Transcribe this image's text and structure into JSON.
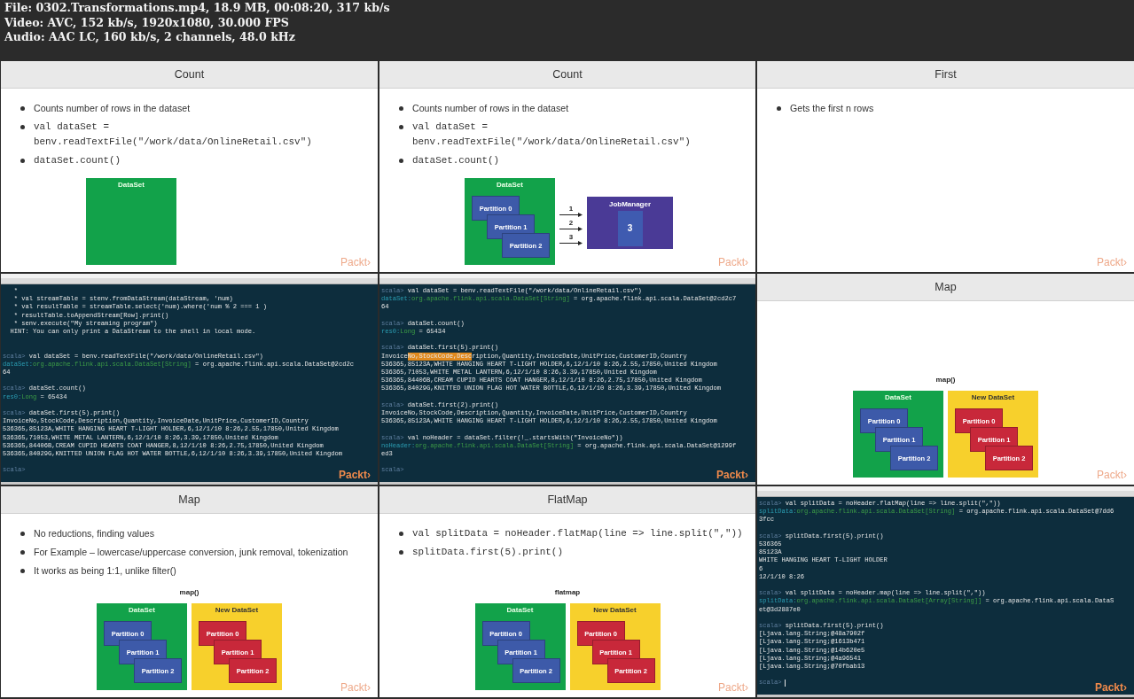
{
  "header": {
    "lines": [
      "File: 0302.Transformations.mp4, 18.9 MB, 00:08:20, 317 kb/s",
      "Video: AVC, 152 kb/s, 1920x1080, 30.000 FPS",
      "Audio: AAC LC, 160 kb/s, 2 channels, 48.0 kHz"
    ]
  },
  "cells": [
    {
      "kind": "slide",
      "title": "Count",
      "bullets": [
        {
          "kind": "text",
          "text": "Counts number of rows in the dataset"
        },
        {
          "kind": "code",
          "text": "val dataSet = benv.readTextFile(\"/work/data/OnlineRetail.csv\")"
        },
        {
          "kind": "code",
          "text": "dataSet.count()"
        }
      ],
      "diagram": {
        "kind": "dataset",
        "boxes": [
          {
            "kind": "source",
            "title": "DataSet"
          }
        ]
      },
      "logo": "Packt›"
    },
    {
      "kind": "slide",
      "title": "Count",
      "bullets": [
        {
          "kind": "text",
          "text": "Counts number of rows in the dataset"
        },
        {
          "kind": "code",
          "text": "val dataSet = benv.readTextFile(\"/work/data/OnlineRetail.csv\")"
        },
        {
          "kind": "code",
          "text": "dataSet.count()"
        }
      ],
      "diagram": {
        "kind": "jobmanager",
        "boxes": [
          {
            "kind": "source",
            "title": "DataSet",
            "partitions": [
              "Partition 0",
              "Partition 1",
              "Partition 2"
            ]
          }
        ],
        "arrows": [
          "1",
          "2",
          "3"
        ],
        "target": {
          "title": "JobManager",
          "value": "3"
        }
      },
      "logo": "Packt›"
    },
    {
      "kind": "slide",
      "title": "First",
      "bullets": [
        {
          "kind": "text",
          "text": "Gets the first n rows"
        }
      ],
      "logo": "Packt›"
    },
    {
      "kind": "terminal",
      "lines": [
        {
          "kind": "plain",
          "text": "   *"
        },
        {
          "kind": "plain",
          "text": "   * val streamTable = stenv.fromDataStream(dataStream, 'num)"
        },
        {
          "kind": "plain",
          "text": "   * val resultTable = streamTable.select('num).where('num % 2 === 1 )"
        },
        {
          "kind": "plain",
          "text": "   * resultTable.toAppendStream[Row].print()"
        },
        {
          "kind": "plain",
          "text": "   * senv.execute(\"My streaming program\")"
        },
        {
          "kind": "plain",
          "text": "  HINT: You can only print a DataStream to the shell in local mode."
        },
        {
          "kind": "blank"
        },
        {
          "kind": "blank"
        },
        {
          "kind": "prompt",
          "prompt": "scala>",
          "text": "val dataSet = benv.readTextFile(\"/work/data/OnlineRetail.csv\")"
        },
        {
          "kind": "result",
          "name": "dataSet:",
          "type": "org.apache.flink.api.scala.DataSet[String]",
          "text": "= org.apache.flink.api.scala.DataSet@2cd2c"
        },
        {
          "kind": "plain",
          "text": "64"
        },
        {
          "kind": "blank"
        },
        {
          "kind": "prompt",
          "prompt": "scala>",
          "text": "dataSet.count()"
        },
        {
          "kind": "result",
          "name": "res0:",
          "type": "Long",
          "text": "= 65434"
        },
        {
          "kind": "blank"
        },
        {
          "kind": "prompt",
          "prompt": "scala>",
          "text": "dataSet.first(5).print()"
        },
        {
          "kind": "plain",
          "text": "InvoiceNo,StockCode,Description,Quantity,InvoiceDate,UnitPrice,CustomerID,Country"
        },
        {
          "kind": "plain",
          "text": "536365,85123A,WHITE HANGING HEART T-LIGHT HOLDER,6,12/1/10 8:26,2.55,17850,United Kingdom"
        },
        {
          "kind": "plain",
          "text": "536365,71053,WHITE METAL LANTERN,6,12/1/10 8:26,3.39,17850,United Kingdom"
        },
        {
          "kind": "plain",
          "text": "536365,84406B,CREAM CUPID HEARTS COAT HANGER,8,12/1/10 8:26,2.75,17850,United Kingdom"
        },
        {
          "kind": "plain",
          "text": "536365,84029G,KNITTED UNION FLAG HOT WATER BOTTLE,6,12/1/10 8:26,3.39,17850,United Kingdom"
        },
        {
          "kind": "blank"
        },
        {
          "kind": "prompt",
          "prompt": "scala>"
        }
      ],
      "logo": "Packt›"
    },
    {
      "kind": "terminal",
      "lines": [
        {
          "kind": "prompt",
          "prompt": "scala>",
          "text": "val dataSet = benv.readTextFile(\"/work/data/OnlineRetail.csv\")"
        },
        {
          "kind": "result",
          "name": "dataSet:",
          "type": "org.apache.flink.api.scala.DataSet[String]",
          "text": "= org.apache.flink.api.scala.DataSet@2cd2c7"
        },
        {
          "kind": "plain",
          "text": "64"
        },
        {
          "kind": "blank"
        },
        {
          "kind": "prompt",
          "prompt": "scala>",
          "text": "dataSet.count()"
        },
        {
          "kind": "result",
          "name": "res0:",
          "type": "Long",
          "text": "= 65434"
        },
        {
          "kind": "blank"
        },
        {
          "kind": "prompt",
          "prompt": "scala>",
          "text": "dataSet.first(5).print()"
        },
        {
          "kind": "plain",
          "parts": [
            {
              "text": "Invoice",
              "highlighted": false
            },
            {
              "text": "No,StockCode,Desc",
              "highlighted": true
            },
            {
              "text": "ription,Quantity,InvoiceDate,UnitPrice,CustomerID,Country",
              "highlighted": false
            }
          ]
        },
        {
          "kind": "plain",
          "text": "536365,85123A,WHITE HANGING HEART T-LIGHT HOLDER,6,12/1/10 8:26,2.55,17850,United Kingdom"
        },
        {
          "kind": "plain",
          "text": "536365,71053,WHITE METAL LANTERN,6,12/1/10 8:26,3.39,17850,United Kingdom"
        },
        {
          "kind": "plain",
          "text": "536365,84406B,CREAM CUPID HEARTS COAT HANGER,8,12/1/10 8:26,2.75,17850,United Kingdom"
        },
        {
          "kind": "plain",
          "text": "536365,84029G,KNITTED UNION FLAG HOT WATER BOTTLE,6,12/1/10 8:26,3.39,17850,United Kingdom"
        },
        {
          "kind": "blank"
        },
        {
          "kind": "prompt",
          "prompt": "scala>",
          "text": "dataSet.first(2).print()"
        },
        {
          "kind": "plain",
          "text": "InvoiceNo,StockCode,Description,Quantity,InvoiceDate,UnitPrice,CustomerID,Country"
        },
        {
          "kind": "plain",
          "text": "536365,85123A,WHITE HANGING HEART T-LIGHT HOLDER,6,12/1/10 8:26,2.55,17850,United Kingdom"
        },
        {
          "kind": "blank"
        },
        {
          "kind": "prompt",
          "prompt": "scala>",
          "text": "val noHeader = dataSet.filter(!_.startsWith(\"InvoiceNo\"))"
        },
        {
          "kind": "result",
          "name": "noHeader:",
          "type": "org.apache.flink.api.scala.DataSet[String]",
          "text": "= org.apache.flink.api.scala.DataSet@1299f"
        },
        {
          "kind": "plain",
          "text": "ed3"
        },
        {
          "kind": "blank"
        },
        {
          "kind": "prompt",
          "prompt": "scala>"
        }
      ],
      "logo": "Packt›"
    },
    {
      "kind": "slide",
      "title": "Map",
      "diagram": {
        "kind": "transform",
        "caption": "map()",
        "boxes": [
          {
            "kind": "source",
            "title": "DataSet",
            "partitions": [
              "Partition 0",
              "Partition 1",
              "Partition 2"
            ]
          },
          {
            "kind": "result",
            "title": "New DataSet",
            "partitions": [
              "Partition 0",
              "Partition 1",
              "Partition 2"
            ]
          }
        ]
      },
      "logo": "Packt›"
    },
    {
      "kind": "slide",
      "title": "Map",
      "bullets": [
        {
          "kind": "text",
          "text": "No reductions, finding values"
        },
        {
          "kind": "text",
          "text": "For Example – lowercase/uppercase conversion, junk removal, tokenization"
        },
        {
          "kind": "text",
          "text": "It works as being 1:1, unlike filter()"
        }
      ],
      "diagram": {
        "kind": "transform",
        "caption": "map()",
        "boxes": [
          {
            "kind": "source",
            "title": "DataSet",
            "partitions": [
              "Partition 0",
              "Partition 1",
              "Partition 2"
            ]
          },
          {
            "kind": "result",
            "title": "New DataSet",
            "partitions": [
              "Partition 0",
              "Partition 1",
              "Partition 2"
            ]
          }
        ]
      },
      "logo": "Packt›"
    },
    {
      "kind": "slide",
      "title": "FlatMap",
      "bullets": [
        {
          "kind": "code",
          "text": "val splitData = noHeader.flatMap(line => line.split(\",\"))"
        },
        {
          "kind": "code",
          "text": "splitData.first(5).print()"
        }
      ],
      "diagram": {
        "kind": "transform",
        "caption": "flatmap",
        "boxes": [
          {
            "kind": "source",
            "title": "DataSet",
            "partitions": [
              "Partition 0",
              "Partition 1",
              "Partition 2"
            ]
          },
          {
            "kind": "result",
            "title": "New DataSet",
            "partitions": [
              "Partition 0",
              "Partition 1",
              "Partition 2"
            ]
          }
        ]
      },
      "logo": "Packt›"
    },
    {
      "kind": "terminal",
      "lines": [
        {
          "kind": "prompt",
          "prompt": "scala>",
          "text": "val splitData = noHeader.flatMap(line => line.split(\",\"))"
        },
        {
          "kind": "result",
          "name": "splitData:",
          "type": "org.apache.flink.api.scala.DataSet[String]",
          "text": "= org.apache.flink.api.scala.DataSet@7dd6"
        },
        {
          "kind": "plain",
          "text": "3fcc"
        },
        {
          "kind": "blank"
        },
        {
          "kind": "prompt",
          "prompt": "scala>",
          "text": "splitData.first(5).print()"
        },
        {
          "kind": "plain",
          "text": "536365"
        },
        {
          "kind": "plain",
          "text": "85123A"
        },
        {
          "kind": "plain",
          "text": "WHITE HANGING HEART T-LIGHT HOLDER"
        },
        {
          "kind": "plain",
          "text": "6"
        },
        {
          "kind": "plain",
          "text": "12/1/10 8:26"
        },
        {
          "kind": "blank"
        },
        {
          "kind": "prompt",
          "prompt": "scala>",
          "text": "val splitData = noHeader.map(line => line.split(\",\"))"
        },
        {
          "kind": "result",
          "name": "splitData:",
          "type": "org.apache.flink.api.scala.DataSet[Array[String]]",
          "text": "= org.apache.flink.api.scala.DataS"
        },
        {
          "kind": "plain",
          "text": "et@3d2887e0"
        },
        {
          "kind": "blank"
        },
        {
          "kind": "prompt",
          "prompt": "scala>",
          "text": "splitData.first(5).print()"
        },
        {
          "kind": "plain",
          "text": "[Ljava.lang.String;@48a7902f"
        },
        {
          "kind": "plain",
          "text": "[Ljava.lang.String;@1613b471"
        },
        {
          "kind": "plain",
          "text": "[Ljava.lang.String;@14b620e5"
        },
        {
          "kind": "plain",
          "text": "[Ljava.lang.String;@4a96541"
        },
        {
          "kind": "plain",
          "text": "[Ljava.lang.String;@70fbab13"
        },
        {
          "kind": "blank"
        },
        {
          "kind": "prompt",
          "prompt": "scala>",
          "cursor": true
        }
      ],
      "logo": "Packt›"
    }
  ]
}
